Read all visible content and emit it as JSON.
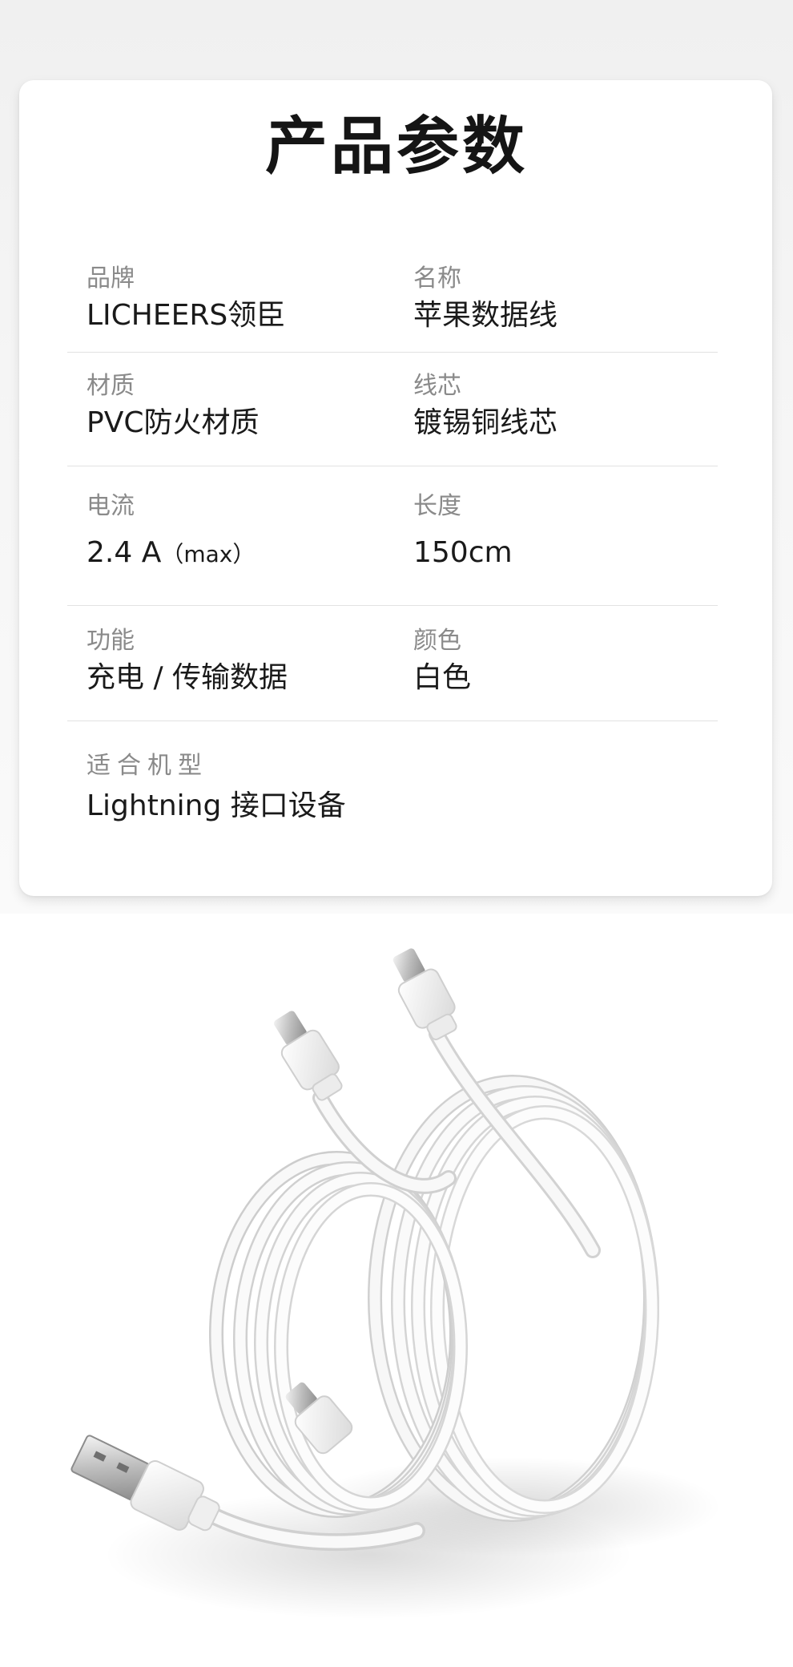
{
  "title": "产品参数",
  "specs": [
    {
      "left": {
        "label": "品牌",
        "value": "LICHEERS领臣"
      },
      "right": {
        "label": "名称",
        "value": "苹果数据线"
      }
    },
    {
      "left": {
        "label": "材质",
        "value": "PVC防火材质"
      },
      "right": {
        "label": "线芯",
        "value": "镀锡铜线芯"
      }
    },
    {
      "left": {
        "label": "电流",
        "value": "2.4 A",
        "value_suffix": "（max）"
      },
      "right": {
        "label": "长度",
        "value": "150cm"
      }
    },
    {
      "left": {
        "label": "功能",
        "value": "充电 / 传输数据"
      },
      "right": {
        "label": "颜色",
        "value": "白色"
      }
    },
    {
      "left": {
        "label": "适合机型",
        "value": "Lightning 接口设备"
      }
    }
  ],
  "image": {
    "icon": "usb-lightning-cable-icon"
  }
}
